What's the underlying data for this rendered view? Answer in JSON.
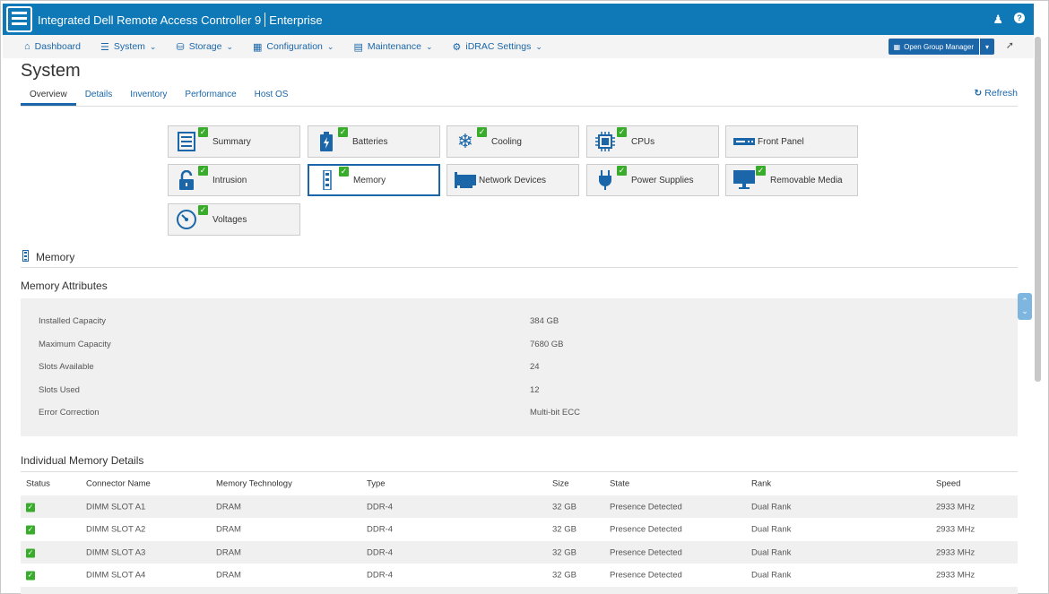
{
  "app": {
    "title": "Integrated Dell Remote Access Controller 9",
    "edition": "Enterprise",
    "user_icon": "user-icon",
    "help_icon": "help-icon"
  },
  "nav": {
    "items": [
      {
        "label": "Dashboard",
        "icon": "home-icon"
      },
      {
        "label": "System",
        "icon": "server-icon"
      },
      {
        "label": "Storage",
        "icon": "database-icon"
      },
      {
        "label": "Configuration",
        "icon": "config-icon"
      },
      {
        "label": "Maintenance",
        "icon": "maintenance-icon"
      },
      {
        "label": "iDRAC Settings",
        "icon": "settings-icon"
      }
    ],
    "group_manager_label": "Open Group Manager"
  },
  "page": {
    "title": "System",
    "tabs": [
      "Overview",
      "Details",
      "Inventory",
      "Performance",
      "Host OS"
    ],
    "active_tab": "Overview",
    "refresh_label": "Refresh"
  },
  "tiles": [
    {
      "label": "Summary",
      "icon": "summary-icon",
      "check": true
    },
    {
      "label": "Batteries",
      "icon": "battery-icon",
      "check": true
    },
    {
      "label": "Cooling",
      "icon": "snowflake-icon",
      "check": true
    },
    {
      "label": "CPUs",
      "icon": "cpu-icon",
      "check": true
    },
    {
      "label": "Front Panel",
      "icon": "front-panel-icon",
      "check": false
    },
    {
      "label": "Intrusion",
      "icon": "lock-icon",
      "check": true
    },
    {
      "label": "Memory",
      "icon": "memory-icon",
      "check": true
    },
    {
      "label": "Network Devices",
      "icon": "network-card-icon",
      "check": false
    },
    {
      "label": "Power Supplies",
      "icon": "plug-icon",
      "check": true
    },
    {
      "label": "Removable Media",
      "icon": "monitor-icon",
      "check": true
    },
    {
      "label": "Voltages",
      "icon": "gauge-icon",
      "check": true
    }
  ],
  "memory": {
    "section_title": "Memory",
    "attributes_title": "Memory Attributes",
    "attributes": [
      {
        "label": "Installed Capacity",
        "value": "384 GB"
      },
      {
        "label": "Maximum Capacity",
        "value": "7680 GB"
      },
      {
        "label": "Slots Available",
        "value": "24"
      },
      {
        "label": "Slots Used",
        "value": "12"
      },
      {
        "label": "Error Correction",
        "value": "Multi-bit ECC"
      }
    ],
    "details_title": "Individual Memory Details",
    "columns": [
      "Status",
      "Connector Name",
      "Memory Technology",
      "Type",
      "Size",
      "State",
      "Rank",
      "Speed"
    ],
    "rows": [
      {
        "connector": "DIMM SLOT A1",
        "tech": "DRAM",
        "type": "DDR-4",
        "size": "32 GB",
        "state": "Presence Detected",
        "rank": "Dual Rank",
        "speed": "2933 MHz"
      },
      {
        "connector": "DIMM SLOT A2",
        "tech": "DRAM",
        "type": "DDR-4",
        "size": "32 GB",
        "state": "Presence Detected",
        "rank": "Dual Rank",
        "speed": "2933 MHz"
      },
      {
        "connector": "DIMM SLOT A3",
        "tech": "DRAM",
        "type": "DDR-4",
        "size": "32 GB",
        "state": "Presence Detected",
        "rank": "Dual Rank",
        "speed": "2933 MHz"
      },
      {
        "connector": "DIMM SLOT A4",
        "tech": "DRAM",
        "type": "DDR-4",
        "size": "32 GB",
        "state": "Presence Detected",
        "rank": "Dual Rank",
        "speed": "2933 MHz"
      }
    ]
  },
  "colors": {
    "brand": "#0f79b8",
    "link": "#1a66a8",
    "ok": "#3aac2c"
  }
}
